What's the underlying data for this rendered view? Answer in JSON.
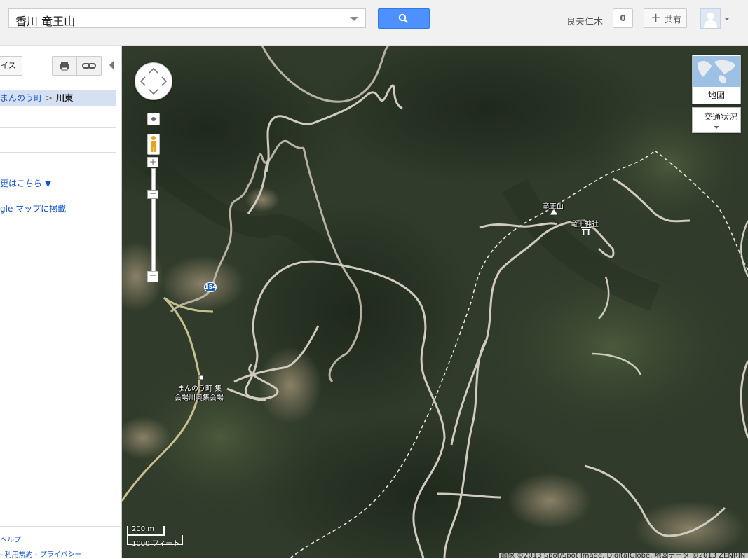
{
  "search": {
    "query": "香川  竜王山"
  },
  "header": {
    "user_name": "良夫仁木",
    "notification_count": "0",
    "share_label": "共有"
  },
  "sidebar": {
    "places_label": "イス",
    "breadcrumb": {
      "parent": "まんのう町",
      "separator": ">",
      "current": "川東"
    },
    "change_link": "更はこちら ▼",
    "post_link": "gle マップに掲載",
    "footer_help": "ヘルプ",
    "footer_terms": "- 利用規約 - プライバシー"
  },
  "map": {
    "labels": {
      "ryuo_mountain": "竜王山",
      "ryuo_shrine": "竜王神社",
      "assembly_hall_line1": "まんのう町 集",
      "assembly_hall_line2": "会場川奥集会場",
      "route_shield": "154"
    },
    "maptype_label": "地図",
    "traffic_label": "交通状況",
    "scale_metric": "200 m",
    "scale_imperial": "1000 フィート",
    "copyright": "画像 ©2013 Spot/Spot Image, DigitalGlobe, 地図データ ©2013 ZENRIN"
  },
  "colors": {
    "search_button": "#4d90fe",
    "link": "#1155cc",
    "breadcrumb_bg": "#d5e0f2",
    "route_shield": "#1a5fb4"
  },
  "icons": [
    "search-icon",
    "printer-icon",
    "link-icon",
    "collapse-left-icon",
    "plus-icon",
    "avatar-icon",
    "pan-icon",
    "pegman-icon",
    "zoom-in-icon",
    "zoom-out-icon",
    "peak-icon",
    "shrine-icon",
    "building-icon"
  ]
}
